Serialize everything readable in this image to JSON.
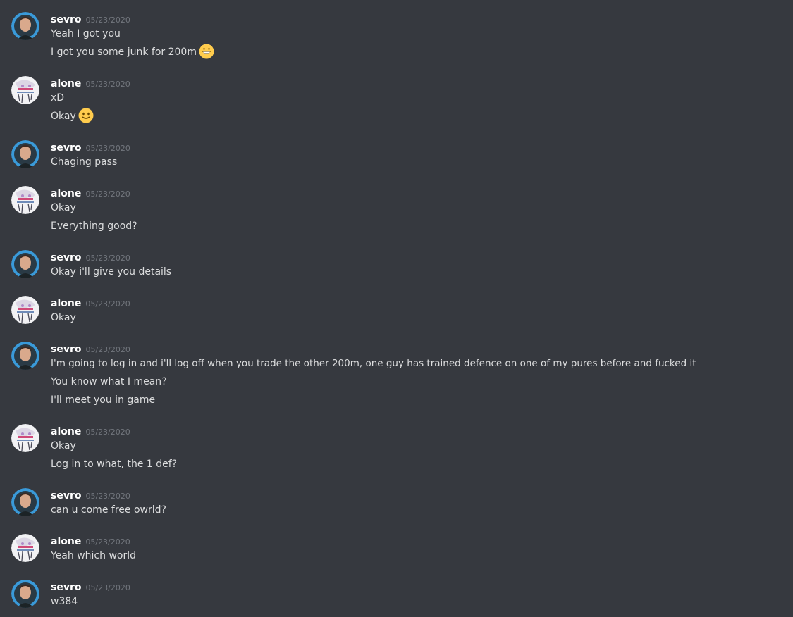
{
  "messages": [
    {
      "author": "sevro",
      "timestamp": "05/23/2020",
      "lines": [
        {
          "text": "Yeah I got you"
        },
        {
          "text": "I got you some junk for 200m",
          "emoji": "grinning-face-emoji"
        }
      ]
    },
    {
      "author": "alone",
      "timestamp": "05/23/2020",
      "lines": [
        {
          "text": "xD"
        },
        {
          "text": "Okay",
          "emoji": "slightly-smiling-face-emoji"
        }
      ]
    },
    {
      "author": "sevro",
      "timestamp": "05/23/2020",
      "lines": [
        {
          "text": "Chaging pass"
        }
      ]
    },
    {
      "author": "alone",
      "timestamp": "05/23/2020",
      "lines": [
        {
          "text": "Okay"
        },
        {
          "text": "Everything good?"
        }
      ]
    },
    {
      "author": "sevro",
      "timestamp": "05/23/2020",
      "lines": [
        {
          "text": "Okay i'll give you details"
        }
      ]
    },
    {
      "author": "alone",
      "timestamp": "05/23/2020",
      "lines": [
        {
          "text": "Okay"
        }
      ]
    },
    {
      "author": "sevro",
      "timestamp": "05/23/2020",
      "lines": [
        {
          "text": "I'm going to log in and i'll log off when you trade the other 200m, one guy has trained defence on one of my pures before and fucked it"
        },
        {
          "text": "You know what I mean?"
        },
        {
          "text": "I'll meet you in game"
        }
      ]
    },
    {
      "author": "alone",
      "timestamp": "05/23/2020",
      "lines": [
        {
          "text": "Okay"
        },
        {
          "text": "Log in to what, the 1 def?"
        }
      ]
    },
    {
      "author": "sevro",
      "timestamp": "05/23/2020",
      "lines": [
        {
          "text": "can u come free owrld?"
        }
      ]
    },
    {
      "author": "alone",
      "timestamp": "05/23/2020",
      "lines": [
        {
          "text": "Yeah which world"
        }
      ]
    },
    {
      "author": "sevro",
      "timestamp": "05/23/2020",
      "lines": [
        {
          "text": "w384"
        }
      ]
    }
  ],
  "colors": {
    "background": "#36393f",
    "author": "#ffffff",
    "timestamp": "#72767d",
    "message_text": "#dcddde",
    "sevro_avatar_ring": "#3a9ad9",
    "emoji_yellow": "#ffcc4d"
  }
}
